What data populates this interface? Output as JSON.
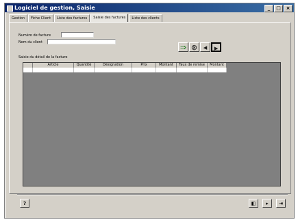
{
  "window": {
    "title": "Logiciel de gestion, Saisie"
  },
  "tabs": [
    {
      "label": "Gestion",
      "active": false
    },
    {
      "label": "Fiche Client",
      "active": false
    },
    {
      "label": "Liste des factures",
      "active": false
    },
    {
      "label": "Saisie des factures",
      "active": true
    },
    {
      "label": "Liste des clients",
      "active": false
    }
  ],
  "form": {
    "invoice_number_label": "Numéro de facture",
    "invoice_number_value": "",
    "invoice_number_suffix": "",
    "client_label": "Nom du client",
    "client_value": "",
    "details_label": "Saisie du détail de la facture"
  },
  "toolbar": {
    "add_icon": "add-row-icon",
    "search_icon": "binoculars-icon",
    "prev_icon": "arrow-left-icon",
    "next_icon": "arrow-right-icon"
  },
  "grid": {
    "columns": [
      "",
      "Article",
      "Quantité",
      "Désignation",
      "Prix",
      "Montant",
      "Taux de remise",
      "Montant"
    ],
    "rows": [
      [
        "",
        "",
        "",
        "",
        "",
        "",
        "",
        ""
      ]
    ]
  },
  "bottom": {
    "help_label": "?",
    "nav1": "◧",
    "nav2": "▸",
    "nav3": "⇥"
  }
}
